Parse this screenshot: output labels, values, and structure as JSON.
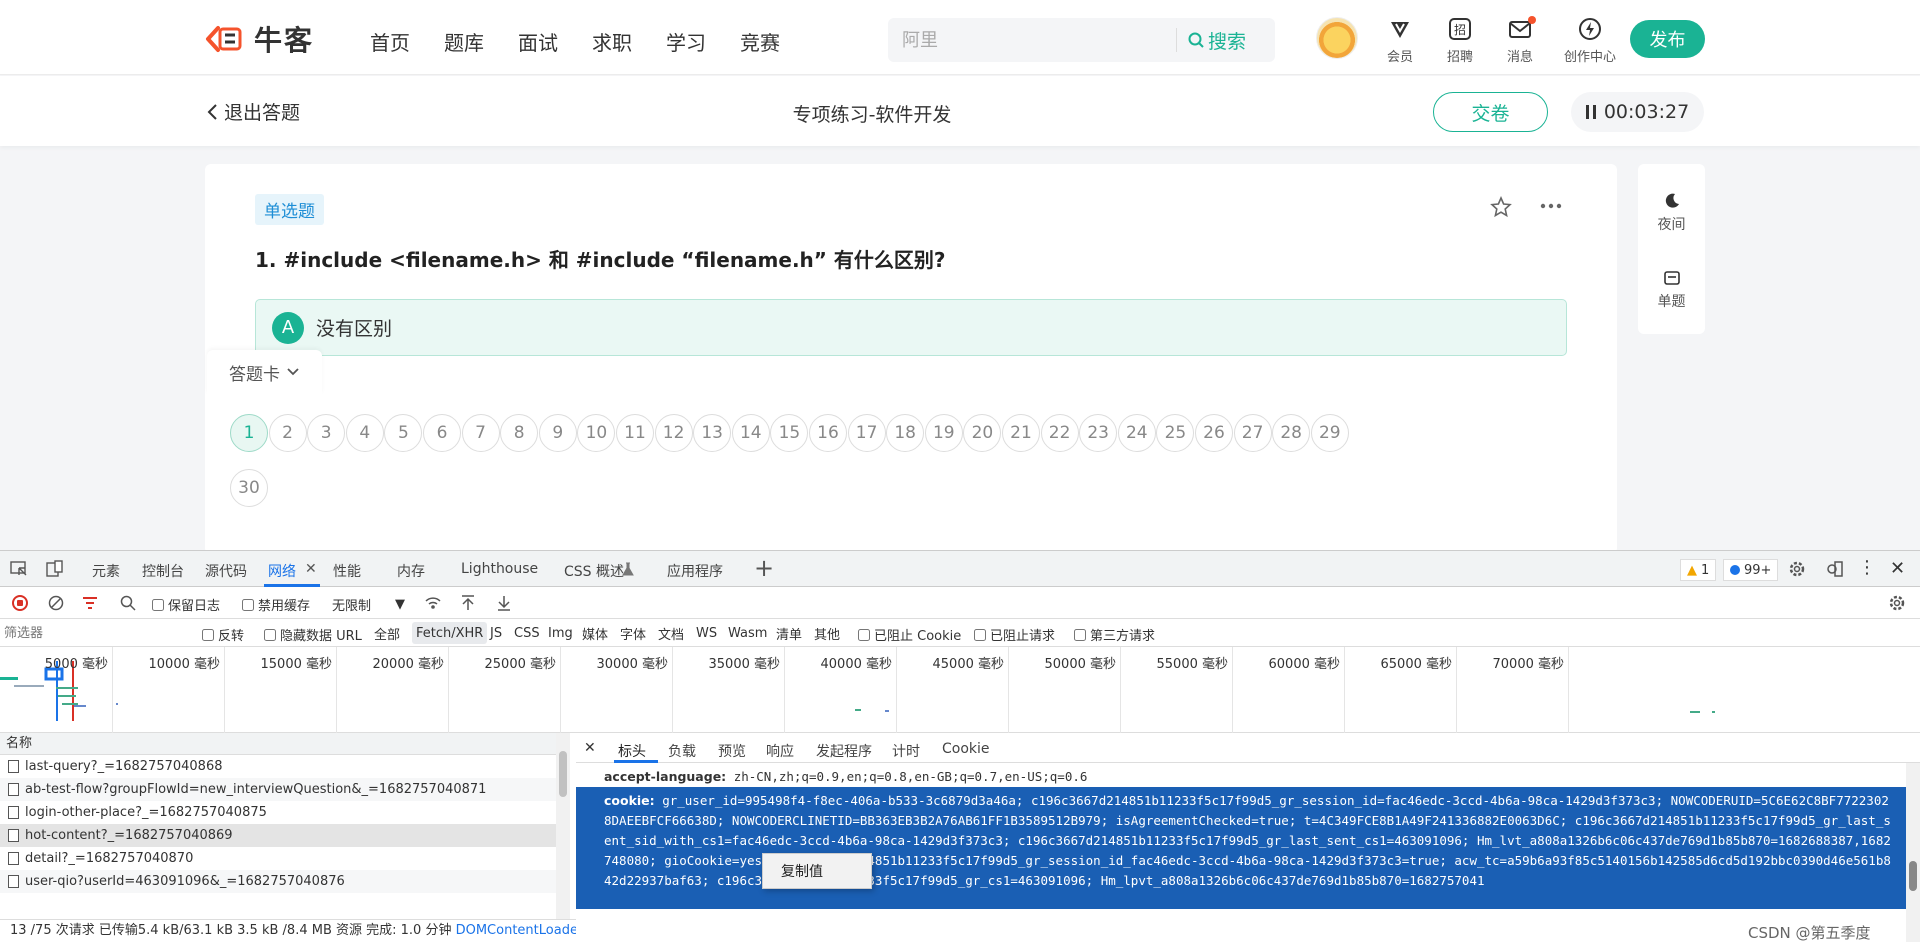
{
  "site": {
    "logo_text": "牛客",
    "nav": [
      "首页",
      "题库",
      "面试",
      "求职",
      "学习",
      "竞赛"
    ],
    "search": {
      "placeholder": "阿里",
      "button": "搜索"
    },
    "header_items": [
      "会员",
      "招聘",
      "消息",
      "创作中心"
    ],
    "publish": "发布"
  },
  "practice": {
    "exit": "退出答题",
    "title": "专项练习-软件开发",
    "submit": "交卷",
    "timer": "00:03:27"
  },
  "question": {
    "type": "单选题",
    "text": "1. #include <filename.h>  和  #include “filename.h”  有什么区别?",
    "options": [
      {
        "letter": "A",
        "text": "没有区别"
      }
    ]
  },
  "side_tools": [
    "夜间",
    "单题"
  ],
  "answer_card": {
    "label": "答题卡",
    "numbers": [
      "1",
      "2",
      "3",
      "4",
      "5",
      "6",
      "7",
      "8",
      "9",
      "10",
      "11",
      "12",
      "13",
      "14",
      "15",
      "16",
      "17",
      "18",
      "19",
      "20",
      "21",
      "22",
      "23",
      "24",
      "25",
      "26",
      "27",
      "28",
      "29",
      "30"
    ],
    "current": "1"
  },
  "devtools": {
    "tabs": [
      "元素",
      "控制台",
      "源代码",
      "网络",
      "性能",
      "内存",
      "Lighthouse",
      "CSS 概述",
      "应用程序"
    ],
    "active_tab": "网络",
    "warnings": "1",
    "messages": "99+",
    "toolbar": {
      "preserve_log": "保留日志",
      "disable_cache": "禁用缓存",
      "throttle": "无限制"
    },
    "filter": {
      "placeholder": "筛选器",
      "invert": "反转",
      "hide_data_url": "隐藏数据 URL",
      "types": [
        "全部",
        "Fetch/XHR",
        "JS",
        "CSS",
        "Img",
        "媒体",
        "字体",
        "文档",
        "WS",
        "Wasm",
        "清单",
        "其他"
      ],
      "active_type": "Fetch/XHR",
      "blocked_cookie": "已阻止 Cookie",
      "blocked_requests": "已阻止请求",
      "third_party": "第三方请求"
    },
    "timeline_labels": [
      "5000 毫秒",
      "10000 毫秒",
      "15000 毫秒",
      "20000 毫秒",
      "25000 毫秒",
      "30000 毫秒",
      "35000 毫秒",
      "40000 毫秒",
      "45000 毫秒",
      "50000 毫秒",
      "55000 毫秒",
      "60000 毫秒",
      "65000 毫秒",
      "70000 毫秒"
    ],
    "list_header": "名称",
    "requests": [
      "last-query?_=1682757040868",
      "ab-test-flow?groupFlowId=new_interviewQuestion&_=1682757040871",
      "login-other-place?_=1682757040875",
      "hot-content?_=1682757040869",
      "detail?_=1682757040870",
      "user-qio?userId=463091096&_=1682757040876"
    ],
    "status_bar": {
      "text": "13 /75 次请求  已传输5.4 kB/63.1 kB  3.5 kB /8.4 MB 资源  完成: 1.0 分钟",
      "dom": "DOMContentLoaded"
    },
    "detail_tabs": [
      "标头",
      "负载",
      "预览",
      "响应",
      "发起程序",
      "计时",
      "Cookie"
    ],
    "active_detail_tab": "标头",
    "accept_language": {
      "key": "accept-language:",
      "value": "zh-CN,zh;q=0.9,en;q=0.8,en-GB;q=0.7,en-US;q=0.6"
    },
    "cookie": {
      "key": "cookie:",
      "value": "gr_user_id=995498f4-f8ec-406a-b533-3c6879d3a46a; c196c3667d214851b11233f5c17f99d5_gr_session_id=fac46edc-3ccd-4b6a-98ca-1429d3f373c3; NOWCODERUID=5C6E62C8BF77223028DAEEBFCF66638D; NOWCODERCLINETID=BB363EB3B2A76AB61FF1B3589512B979; isAgreementChecked=true; t=4C349FCE8B1A49F241336882E0063D6C; c196c3667d214851b11233f5c17f99d5_gr_last_sent_sid_with_cs1=fac46edc-3ccd-4b6a-98ca-1429d3f373c3; c196c3667d214851b11233f5c17f99d5_gr_last_sent_cs1=463091096; Hm_lvt_a808a1326b6c06c437de769d1b85b870=1682688387,1682748080; gioCookie=yes; c196c3667d214851b11233f5c17f99d5_gr_session_id_fac46edc-3ccd-4b6a-98ca-1429d3f373c3=true; acw_tc=a59b6a93f85c5140156b142585d6cd5d192bbc0390d46e561b842d22937baf63; c196c3667d214851b11233f5c17f99d5_gr_cs1=463091096; Hm_lpvt_a808a1326b6c06c437de769d1b85b870=1682757041"
    },
    "context_menu": "复制值"
  },
  "watermark": "CSDN @第五季度",
  "colors": {
    "brand": "#1ab394",
    "devtools_accent": "#1a73e8",
    "selection": "#1a5fb4"
  }
}
